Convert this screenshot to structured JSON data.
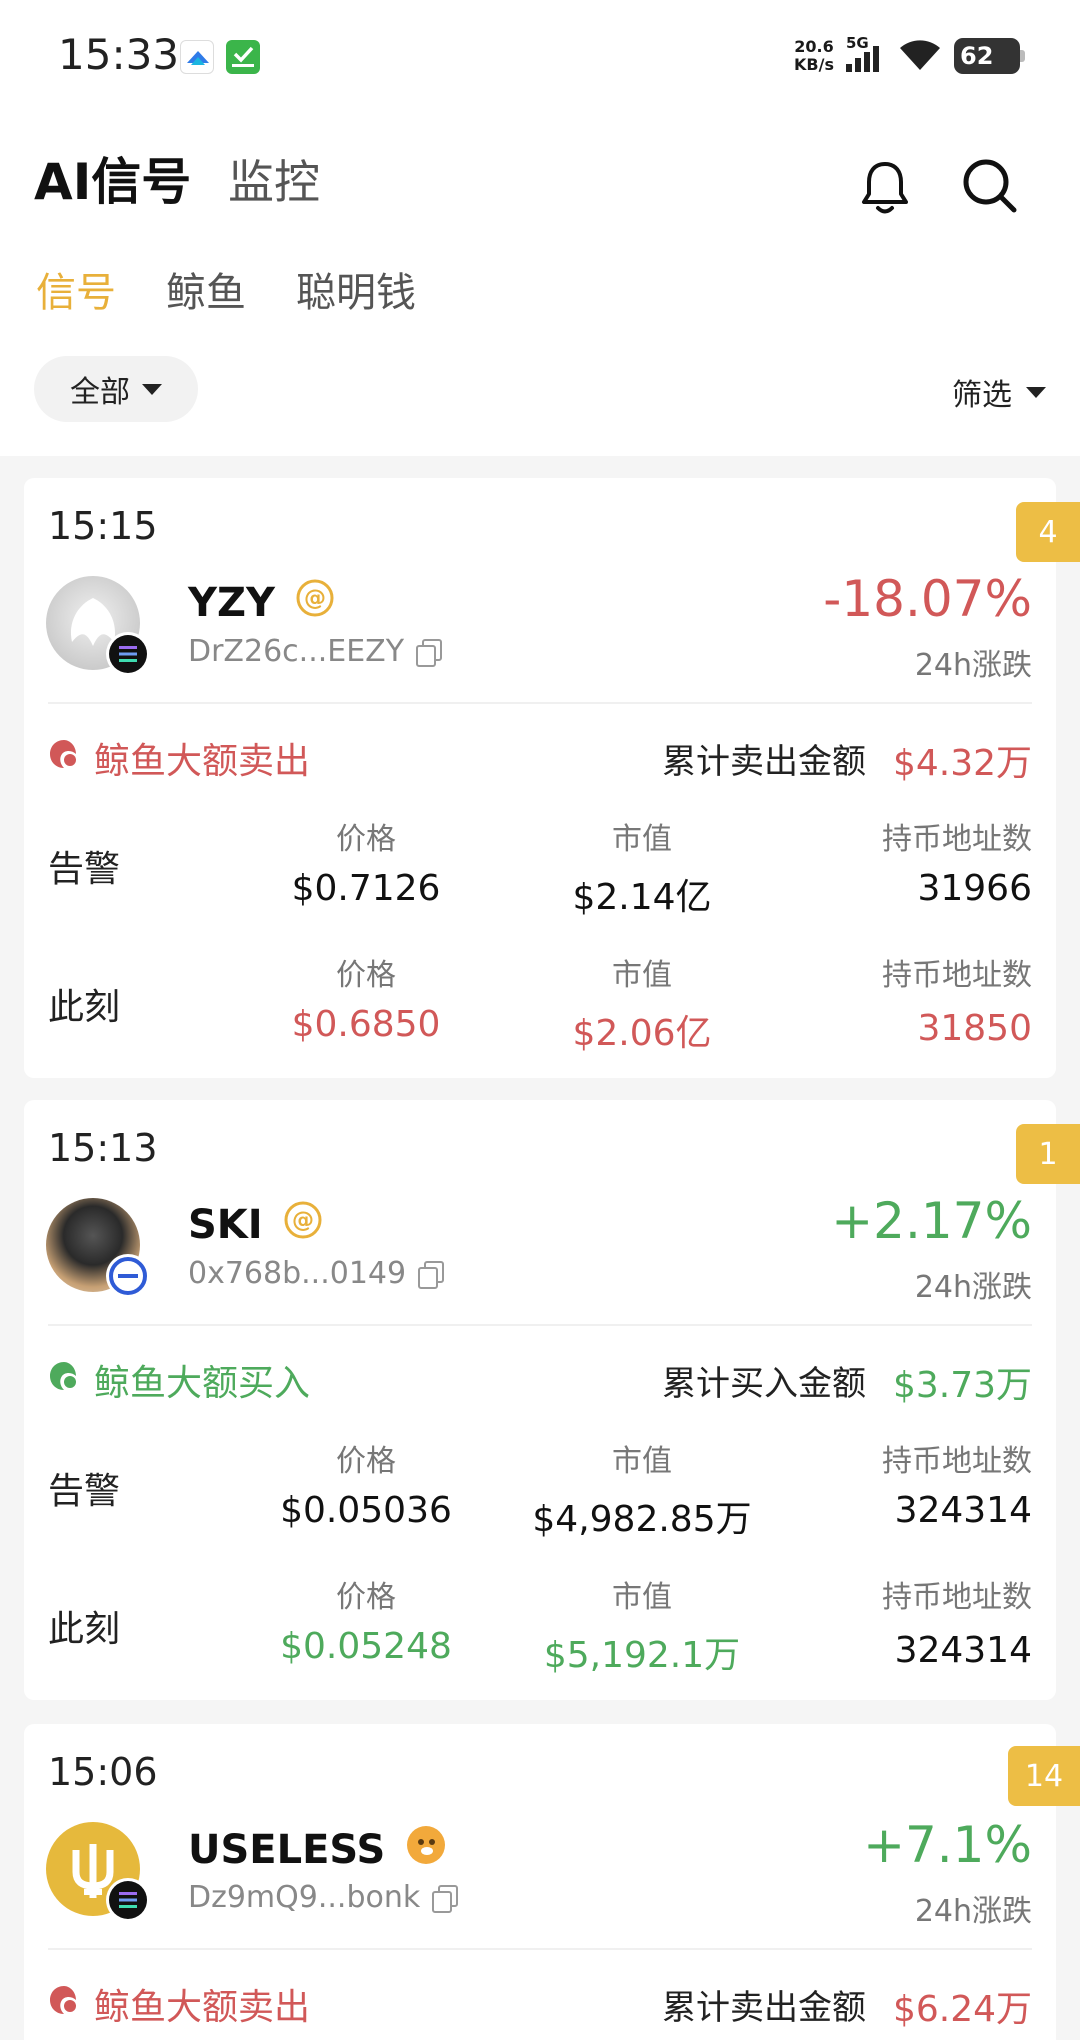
{
  "status_bar": {
    "time": "15:33",
    "net_speed_top": "20.6",
    "net_speed_bottom": "KB/s",
    "network": "5G",
    "battery": "62"
  },
  "header": {
    "title": "AI信号",
    "secondary_title": "监控"
  },
  "tabs": [
    {
      "label": "信号",
      "active": true
    },
    {
      "label": "鲸鱼",
      "active": false
    },
    {
      "label": "聪明钱",
      "active": false
    }
  ],
  "filters": {
    "all_label": "全部",
    "filter_label": "筛选"
  },
  "colors": {
    "accent": "#E8B03A",
    "badge": "#EDBE45",
    "negative": "#D15858",
    "positive": "#4EAA5C"
  },
  "cards": [
    {
      "time": "15:15",
      "badge": "4",
      "symbol": "YZY",
      "address": "DrZ26c...EEZY",
      "change": "-18.07%",
      "change_label": "24h涨跌",
      "trend": "down",
      "whale_label": "鲸鱼大额卖出",
      "cum_label": "累计卖出金额",
      "cum_value": "$4.32万",
      "alert_label": "告警",
      "now_label": "此刻",
      "col_price": "价格",
      "col_mcap": "市值",
      "col_holders": "持币地址数",
      "alert": {
        "price": "$0.7126",
        "mcap": "$2.14亿",
        "holders": "31966"
      },
      "now": {
        "price": "$0.6850",
        "mcap": "$2.06亿",
        "holders": "31850"
      }
    },
    {
      "time": "15:13",
      "badge": "1",
      "symbol": "SKI",
      "address": "0x768b...0149",
      "change": "+2.17%",
      "change_label": "24h涨跌",
      "trend": "up",
      "whale_label": "鲸鱼大额买入",
      "cum_label": "累计买入金额",
      "cum_value": "$3.73万",
      "alert_label": "告警",
      "now_label": "此刻",
      "col_price": "价格",
      "col_mcap": "市值",
      "col_holders": "持币地址数",
      "alert": {
        "price": "$0.05036",
        "mcap": "$4,982.85万",
        "holders": "324314"
      },
      "now": {
        "price": "$0.05248",
        "mcap": "$5,192.1万",
        "holders": "324314"
      }
    },
    {
      "time": "15:06",
      "badge": "14",
      "symbol": "USELESS",
      "address": "Dz9mQ9...bonk",
      "change": "+7.1%",
      "change_label": "24h涨跌",
      "trend": "up",
      "whale_label": "鲸鱼大额卖出",
      "cum_label": "累计卖出金额",
      "cum_value": "$6.24万"
    }
  ]
}
